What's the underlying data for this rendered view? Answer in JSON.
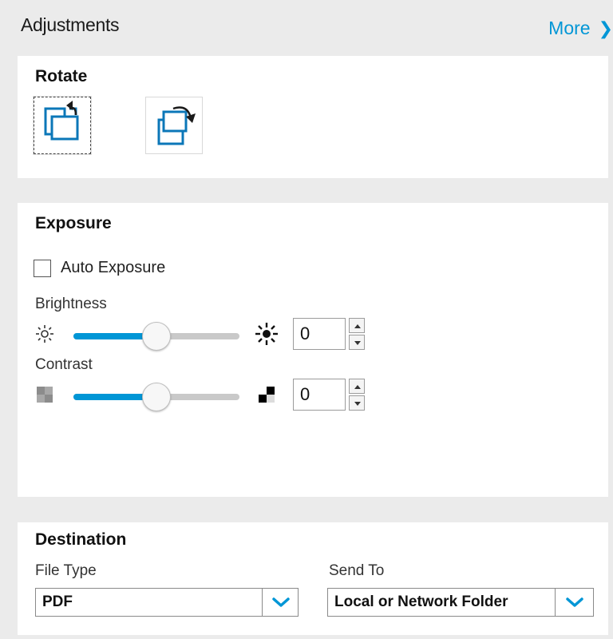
{
  "header": {
    "title": "Adjustments",
    "more_label": "More",
    "accent_color": "#0096d6"
  },
  "rotate": {
    "title": "Rotate",
    "buttons": [
      {
        "icon": "rotate-left-icon",
        "selected": true
      },
      {
        "icon": "rotate-right-icon",
        "selected": false
      }
    ]
  },
  "exposure": {
    "title": "Exposure",
    "auto_exposure": {
      "label": "Auto Exposure",
      "checked": false
    },
    "brightness": {
      "label": "Brightness",
      "value": "0",
      "slider_fraction": 0.5,
      "icon_low": "sun-dim-icon",
      "icon_high": "sun-bright-icon"
    },
    "contrast": {
      "label": "Contrast",
      "value": "0",
      "slider_fraction": 0.5,
      "icon_low": "contrast-low-icon",
      "icon_high": "contrast-high-icon"
    }
  },
  "destination": {
    "title": "Destination",
    "file_type": {
      "label": "File Type",
      "value": "PDF"
    },
    "send_to": {
      "label": "Send To",
      "value": "Local or Network Folder"
    }
  }
}
